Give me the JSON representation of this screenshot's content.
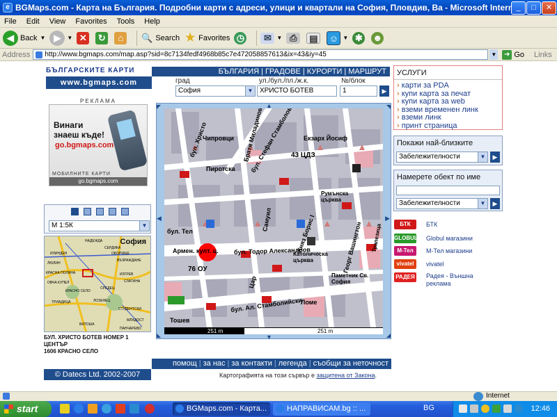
{
  "window": {
    "title": "BGMaps.com - Карта на България. Подробни карти с адреси, улици и квартали на София, Пловдив, Ва - Microsoft Internet Explorer",
    "controls": [
      "_",
      "□",
      "✕"
    ]
  },
  "menu": [
    "File",
    "Edit",
    "View",
    "Favorites",
    "Tools",
    "Help"
  ],
  "toolbar": {
    "back_label": "Back",
    "search_label": "Search",
    "favorites_label": "Favorites"
  },
  "address": {
    "label": "Address",
    "url": "http://www.bgmaps.com/map.asp?sid=8c7134fedf4968b85c7e472058857613&ix=43&iy=45",
    "go_label": "Go",
    "links_label": "Links"
  },
  "site": {
    "brand_title": "БЪЛГАРСКИТЕ КАРТИ",
    "brand_url": "www.bgmaps.com",
    "top_nav": [
      "БЪЛГАРИЯ",
      "ГРАДОВЕ",
      "КУРОРТИ",
      "МАРШРУТ"
    ],
    "search": {
      "city_label": "град",
      "city_value": "София",
      "street_label": "ул./бул./пл./ж.к.",
      "street_value": "ХРИСТО БОТЕВ",
      "number_label": "№/блок",
      "number_value": "1"
    },
    "ad": {
      "caption": "РЕКЛАМА",
      "line1": "Винаги",
      "line2": "знаеш къде!",
      "link": "go.bgmaps.com",
      "tagline": "МОБИЛНИТЕ КАРТИ",
      "bottom": "go.bgmaps.com"
    },
    "scale_value": "М 1:5К",
    "overview": {
      "title": "София",
      "labels": [
        "НАДЕЖДА",
        "СЕРДИКА",
        "ИЛИНДЕН",
        "ОБОРИЩЕ",
        "ЛЮЛИН",
        "ВЪЗРАЖДАНЕ",
        "КРАСНА ПОЛЯНА",
        "ИЗГРЕВ",
        "ОВЧА КУПЕЛ",
        "СЛАТИНА",
        "КРАСНО СЕЛО",
        "СРЕДЕЦ",
        "ЛОЗЕНЕЦ",
        "ТРИАДИЦА",
        "СТУДЕНТСКИ",
        "МЛАДОСТ",
        "ВИТОША",
        "ПАНЧАРЕВО"
      ]
    },
    "address_result": {
      "line1": "БУЛ. ХРИСТО БОТЕВ НОМЕР 1",
      "line2": "ЦЕНТЪР",
      "line3": "1606 КРАСНО СЕЛО"
    },
    "copyright": "© Datecs Ltd. 2002-2007",
    "bottom_nav": [
      "помощ",
      "за нас",
      "за контакти",
      "легенда",
      "съобщи за неточност"
    ],
    "footer_text": "Картографията на този сървър е",
    "footer_link": "защитена от Закона",
    "footer_end": "."
  },
  "map": {
    "labels": [
      {
        "text": "бул. Христо",
        "rot": -70
      },
      {
        "text": "Чипровци",
        "rot": 0
      },
      {
        "text": "Братя Миладинови",
        "rot": -75
      },
      {
        "text": "бул. Стефан Стамболов",
        "rot": -60
      },
      {
        "text": "Екзарх Йосиф",
        "rot": 0
      },
      {
        "text": "43 ЦДЗ",
        "rot": 0
      },
      {
        "text": "Пиротска",
        "rot": 0
      },
      {
        "text": "Румънска църква",
        "rot": 0
      },
      {
        "text": "Самуил",
        "rot": -80
      },
      {
        "text": "бул. Тодор Александров",
        "rot": 0
      },
      {
        "text": "Княз Борис I",
        "rot": -70
      },
      {
        "text": "Католическа църква",
        "rot": 0
      },
      {
        "text": "Георг Вашингтон",
        "rot": -75
      },
      {
        "text": "Армен. култ. ц.",
        "rot": 0
      },
      {
        "text": "76 ОУ",
        "rot": 0
      },
      {
        "text": "бул. Тел",
        "rot": 0
      },
      {
        "text": "Паметник Св. София",
        "rot": 0
      },
      {
        "text": "бул. Ал. Стамболийски",
        "rot": -10
      },
      {
        "text": "Цар",
        "rot": -75
      },
      {
        "text": "Ломе",
        "rot": 0
      },
      {
        "text": "Тошев",
        "rot": 0
      },
      {
        "text": "Трапезица",
        "rot": 0
      }
    ],
    "scale_left": "251 m",
    "scale_right": "251 m",
    "marker_color": "#ff0000"
  },
  "right": {
    "services_title": "УСЛУГИ",
    "services": [
      "карти за PDA",
      "купи карта за печат",
      "купи карта за web",
      "вземи временен линк",
      "вземи линк",
      "принт страница"
    ],
    "nearest_title": "Покажи най-близките",
    "nearest_value": "Забележителности",
    "find_title": "Намерете обект по име",
    "find_value": "",
    "find_select": "Забележителности",
    "legend": [
      {
        "badge": "БТК",
        "text": "БТК",
        "color": "#d01818"
      },
      {
        "badge": "GLOBUL",
        "text": "Globul магазини",
        "color": "#2a9a2a"
      },
      {
        "badge": "M-Тел",
        "text": "М-Тел магазини",
        "color": "#c81870"
      },
      {
        "badge": "vivatel",
        "text": "vivatel",
        "color": "#e04010"
      },
      {
        "badge": "РАДЕЯ",
        "text": "Радея - Външна реклама",
        "color": "#e02020"
      }
    ]
  },
  "status": {
    "zone": "Internet"
  },
  "taskbar": {
    "start": "start",
    "tasks": [
      "BGMaps.com - Карта...",
      "НАПРАВИСАМ.bg :: ..."
    ],
    "lang": "BG",
    "time": "12:46"
  }
}
